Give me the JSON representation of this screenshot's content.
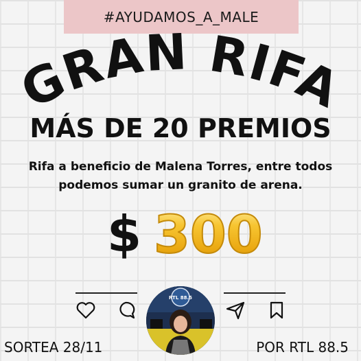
{
  "banner": {
    "hashtag": "#AYUDAMOS_A_MALE"
  },
  "title": {
    "main": "GRAN RIFA",
    "subtitle": "MÁS DE 20 PREMIOS"
  },
  "description": {
    "line1": "Rifa a beneficio de Malena Torres, entre todos",
    "line2": "podemos sumar un granito de arena."
  },
  "price": {
    "currency": "$",
    "amount": "300"
  },
  "social": {
    "icons": [
      "heart-icon",
      "comment-icon",
      "send-icon",
      "bookmark-icon"
    ]
  },
  "avatar": {
    "badge_text": "RTL 88.5"
  },
  "footer": {
    "left": "SORTEA  28/11",
    "right": "POR RTL 88.5"
  },
  "colors": {
    "banner": "#ecc6c8",
    "gold": "#f2b81c",
    "text": "#111111"
  }
}
